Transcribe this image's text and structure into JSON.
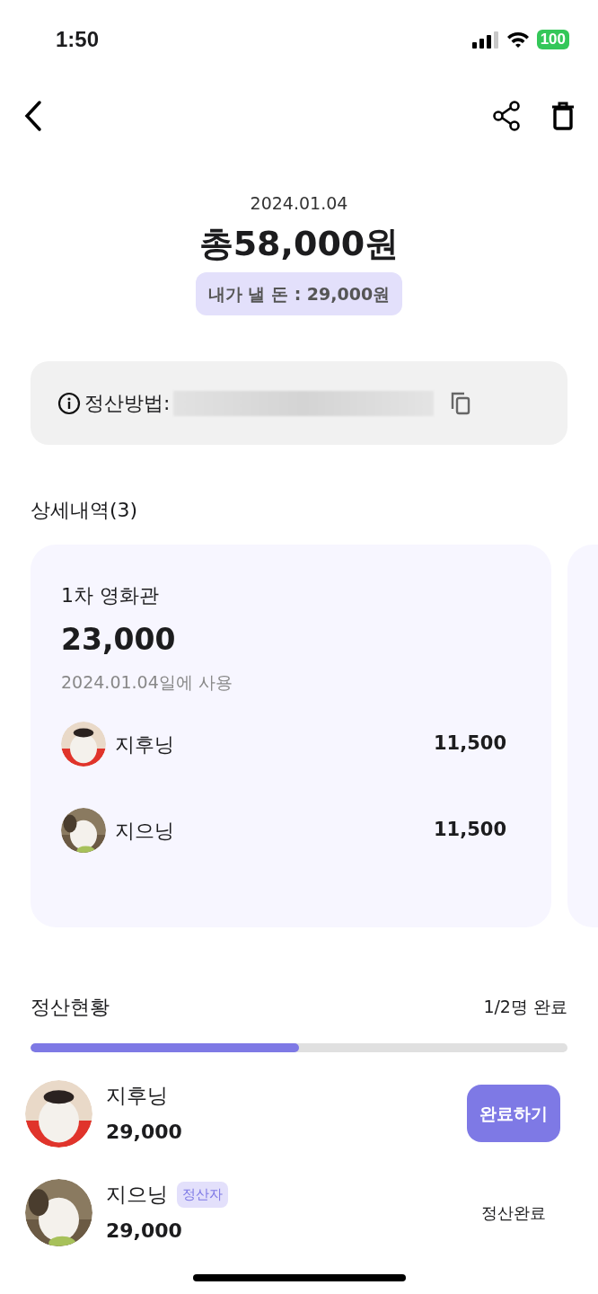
{
  "status_bar": {
    "time": "1:50",
    "battery": "100"
  },
  "summary": {
    "date": "2024.01.04",
    "total": "총58,000원",
    "my_share": "내가 낼 돈 : 29,000원"
  },
  "payment_method": {
    "label": "정산방법:"
  },
  "details": {
    "title": "상세내역(3)",
    "cards": [
      {
        "title": "1차 영화관",
        "amount": "23,000",
        "used": "2024.01.04일에 사용",
        "members": [
          {
            "name": "지후닝",
            "amount": "11,500"
          },
          {
            "name": "지으닝",
            "amount": "11,500"
          }
        ]
      }
    ]
  },
  "status": {
    "title": "정산현황",
    "count": "1/2명 완료",
    "level": 0.5,
    "members": [
      {
        "name": "지후닝",
        "amount": "29,000",
        "kind": "button",
        "action": "완료하기"
      },
      {
        "name": "지으닝",
        "amount": "29,000",
        "badge": "정산자",
        "kind": "text",
        "action": "정산완료"
      }
    ]
  }
}
